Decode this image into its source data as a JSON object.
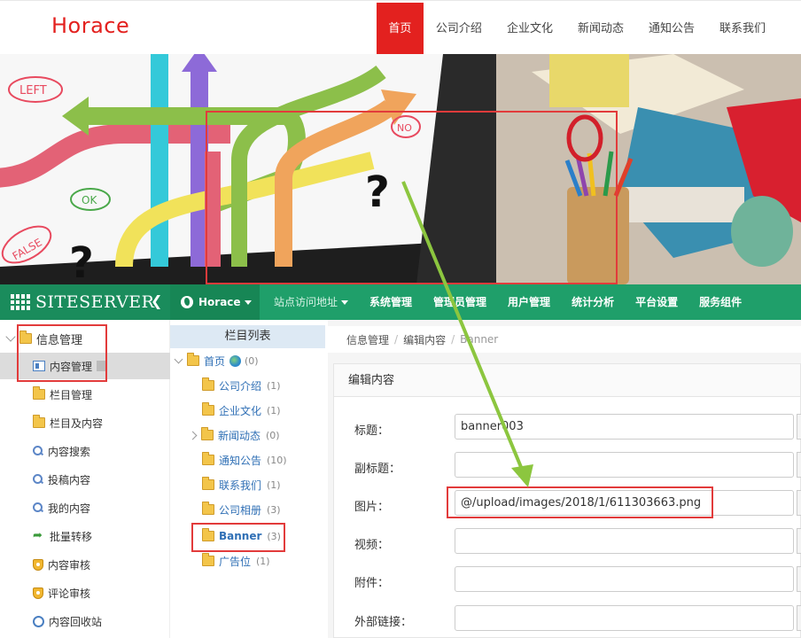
{
  "site": {
    "logo": "Horace",
    "nav": [
      "首页",
      "公司介绍",
      "企业文化",
      "新闻动态",
      "通知公告",
      "联系我们"
    ]
  },
  "banner": {
    "sign_left": "LEFT",
    "sign_no": "NO",
    "sign_ok": "OK",
    "sign_false": "FALSE",
    "question": "?"
  },
  "admin_bar": {
    "brand": "SITESERVER",
    "back_icon": "arrow-left-icon",
    "site_name": "Horace",
    "menu": [
      "站点访问地址",
      "系统管理",
      "管理员管理",
      "用户管理",
      "统计分析",
      "平台设置",
      "服务组件"
    ]
  },
  "left_nav": {
    "group": "信息管理",
    "items": [
      "内容管理",
      "栏目管理",
      "栏目及内容",
      "内容搜索",
      "投稿内容",
      "我的内容",
      "批量转移",
      "内容审核",
      "评论审核",
      "内容回收站"
    ]
  },
  "tree": {
    "header": "栏目列表",
    "root": {
      "name": "首页",
      "count": "(0)"
    },
    "nodes": [
      {
        "name": "公司介绍",
        "count": "(1)"
      },
      {
        "name": "企业文化",
        "count": "(1)"
      },
      {
        "name": "新闻动态",
        "count": "(0)"
      },
      {
        "name": "通知公告",
        "count": "(10)"
      },
      {
        "name": "联系我们",
        "count": "(1)"
      },
      {
        "name": "公司相册",
        "count": "(3)"
      },
      {
        "name": "Banner",
        "count": "(3)"
      },
      {
        "name": "广告位",
        "count": "(1)"
      }
    ]
  },
  "breadcrumb": [
    "信息管理",
    "编辑内容",
    "Banner"
  ],
  "panel": {
    "title": "编辑内容",
    "fields": [
      {
        "label": "标题：",
        "value": "banner003"
      },
      {
        "label": "副标题：",
        "value": ""
      },
      {
        "label": "图片：",
        "value": "@/upload/images/2018/1/611303663.png"
      },
      {
        "label": "视频：",
        "value": ""
      },
      {
        "label": "附件：",
        "value": ""
      },
      {
        "label": "外部链接：",
        "value": ""
      }
    ]
  },
  "colors": {
    "brand_red": "#e3211f",
    "admin_green": "#1f9f6a",
    "annotation_red": "#e23b3b",
    "annotation_arrow": "#8cc63f"
  }
}
